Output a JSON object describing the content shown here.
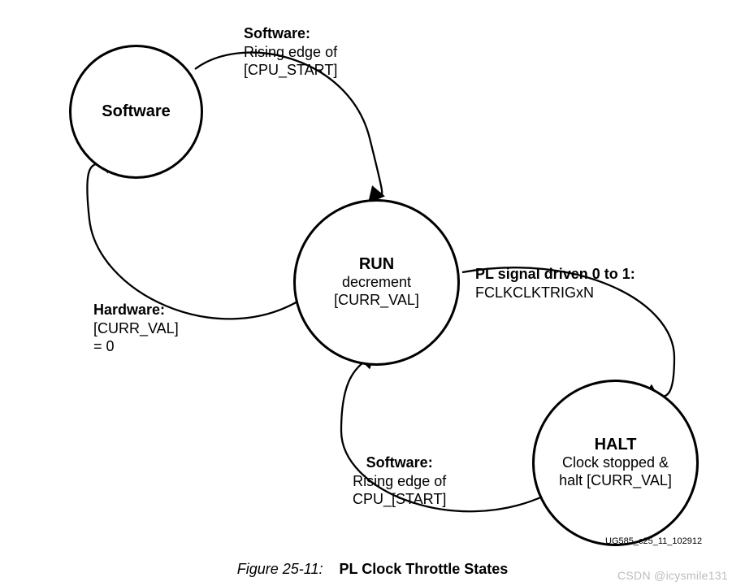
{
  "nodes": {
    "software": {
      "title": "Software"
    },
    "run": {
      "title": "RUN",
      "line1": "decrement",
      "line2": "[CURR_VAL]"
    },
    "halt": {
      "title": "HALT",
      "line1": "Clock stopped &",
      "line2": "halt [CURR_VAL]"
    }
  },
  "edges": {
    "sw_to_run": {
      "head": "Software:",
      "l1": "Rising edge of",
      "l2": "[CPU_START]"
    },
    "run_to_sw": {
      "head": "Hardware:",
      "l1": "[CURR_VAL]",
      "l2": "= 0"
    },
    "run_to_halt": {
      "head": "PL signal driven 0 to 1:",
      "l1": "FCLKCLKTRIGxN"
    },
    "halt_to_run": {
      "head": "Software:",
      "l1": "Rising edge of",
      "l2": "CPU_[START]"
    }
  },
  "caption": {
    "figno": "Figure 25-11:",
    "title": "PL Clock Throttle States"
  },
  "doc_id": "UG585_c25_11_102912",
  "watermark": "CSDN @icysmile131"
}
